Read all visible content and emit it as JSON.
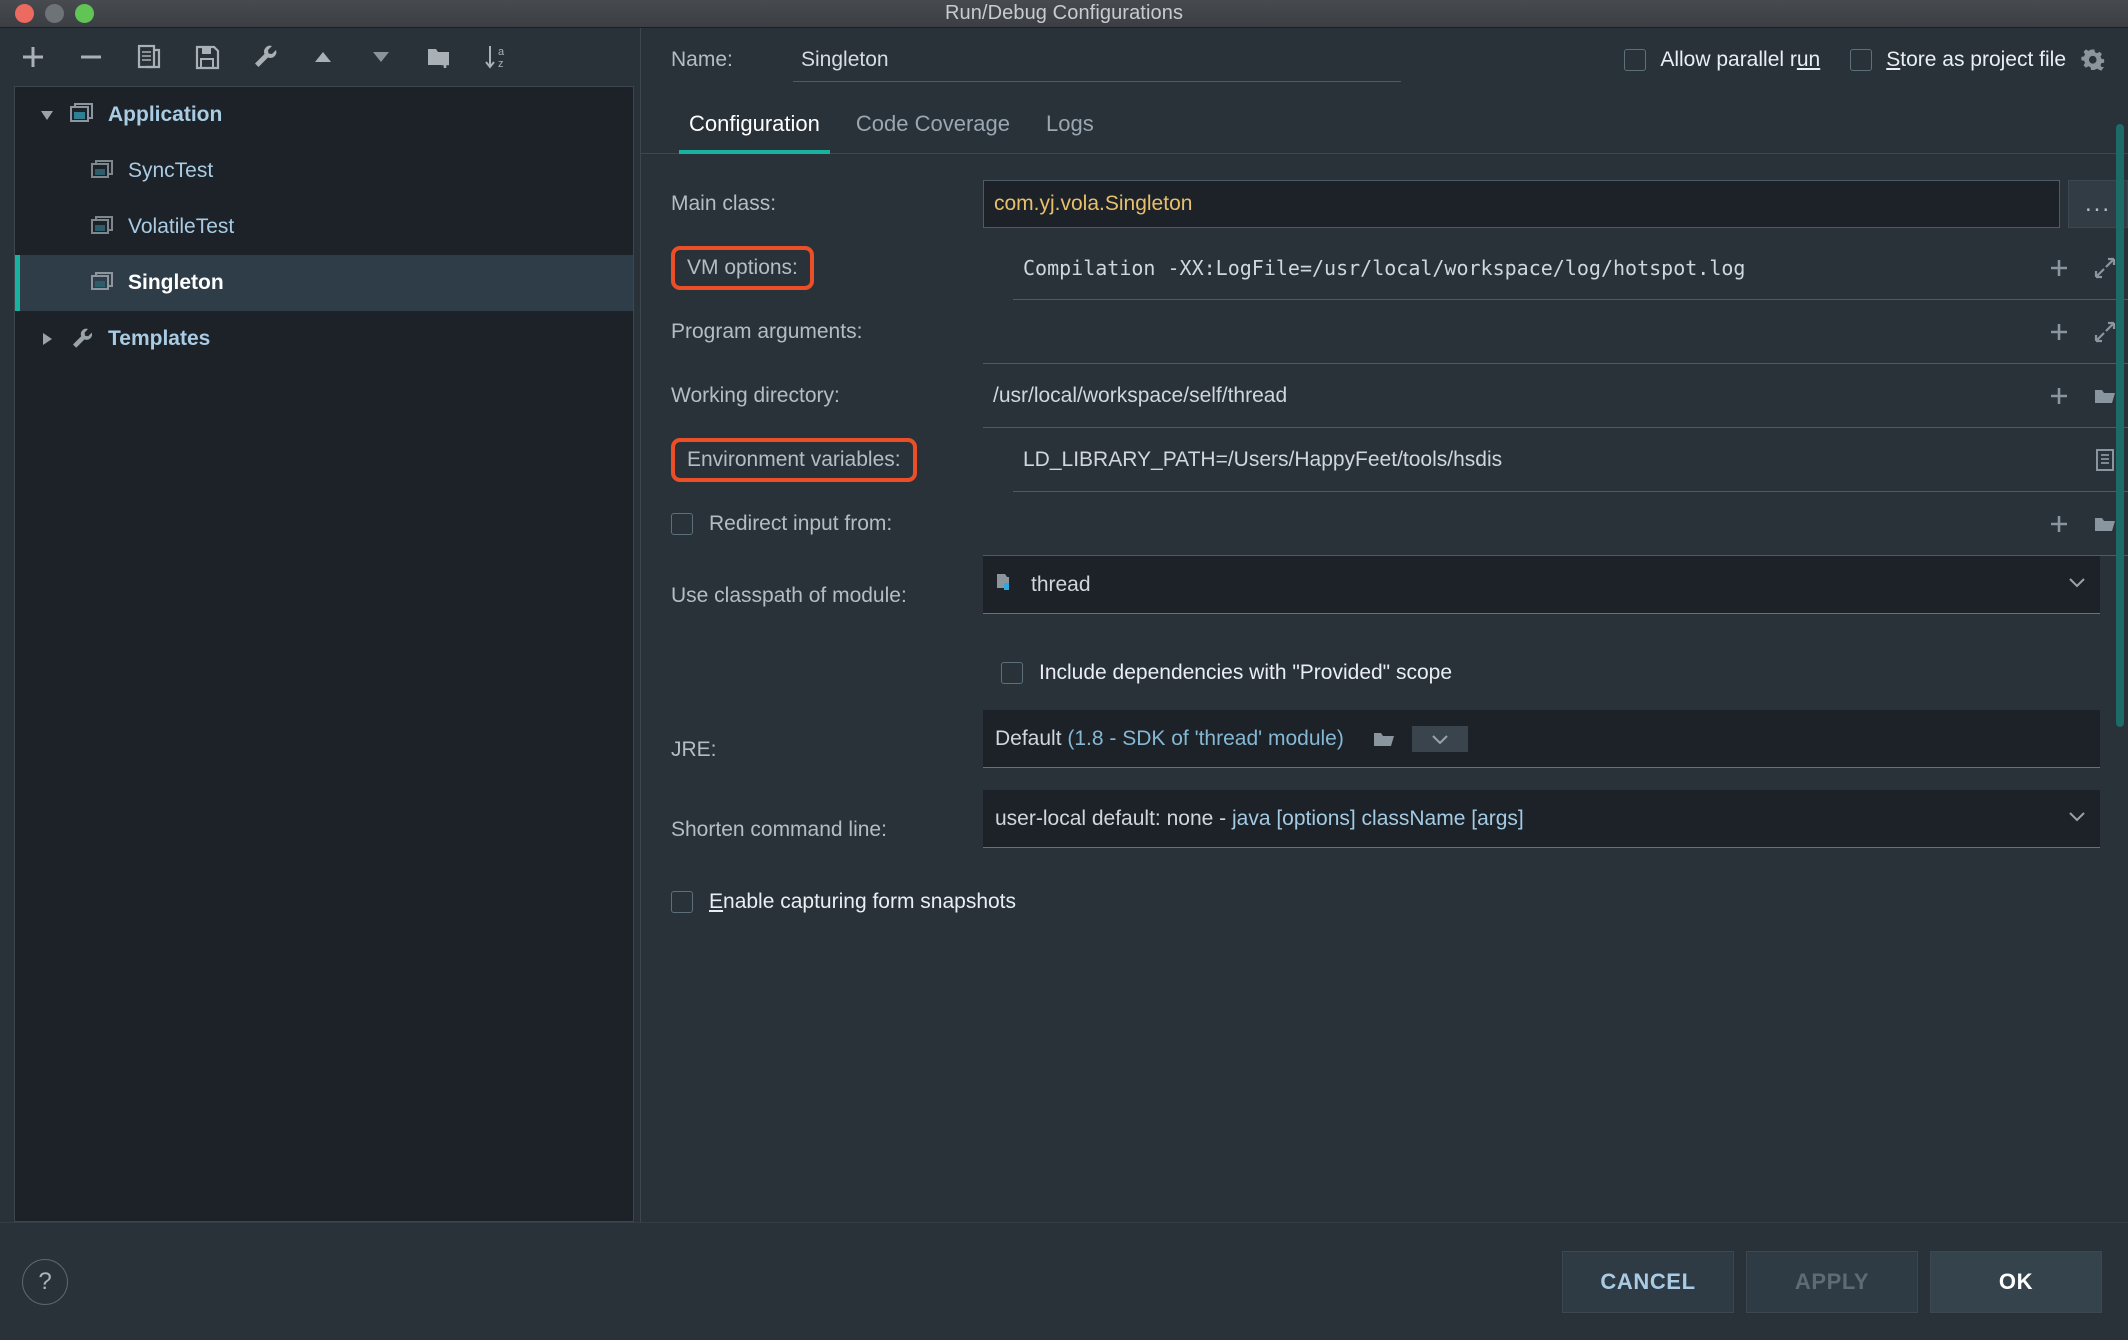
{
  "window": {
    "title": "Run/Debug Configurations"
  },
  "toolbar": {
    "buttons": [
      {
        "name": "add-configuration",
        "icon": "plus-icon"
      },
      {
        "name": "remove-configuration",
        "icon": "minus-icon"
      },
      {
        "name": "copy-configuration",
        "icon": "copy-icon"
      },
      {
        "name": "save-configuration",
        "icon": "save-icon"
      },
      {
        "name": "edit-templates",
        "icon": "wrench-icon"
      },
      {
        "name": "move-up",
        "icon": "triangle-up-icon"
      },
      {
        "name": "move-down",
        "icon": "triangle-down-icon"
      },
      {
        "name": "new-folder",
        "icon": "folder-plus-icon"
      },
      {
        "name": "sort-alphabetically",
        "icon": "sort-az-icon"
      }
    ]
  },
  "tree": {
    "items": [
      {
        "label": "Application",
        "icon": "application-icon",
        "twisty": "expanded",
        "depth": 0,
        "selected": false,
        "bold": true
      },
      {
        "label": "SyncTest",
        "icon": "run-config-icon",
        "twisty": "none",
        "depth": 1,
        "selected": false,
        "bold": false
      },
      {
        "label": "VolatileTest",
        "icon": "run-config-icon",
        "twisty": "none",
        "depth": 1,
        "selected": false,
        "bold": false
      },
      {
        "label": "Singleton",
        "icon": "run-config-icon",
        "twisty": "none",
        "depth": 1,
        "selected": true,
        "bold": true
      },
      {
        "label": "Templates",
        "icon": "wrench-icon",
        "twisty": "collapsed",
        "depth": 0,
        "selected": false,
        "bold": true
      }
    ]
  },
  "header": {
    "name_label": "Name:",
    "name_value": "Singleton",
    "allow_parallel_run": {
      "label_pre": "Allow parallel r",
      "label_mnemonic": "un",
      "label_post": "",
      "checked": false
    },
    "store_as_project_file": {
      "label_mnemonic": "S",
      "label_post": "tore as project file",
      "checked": false
    },
    "gear_icon": "gear-icon"
  },
  "tabs": [
    {
      "label": "Configuration",
      "active": true
    },
    {
      "label": "Code Coverage",
      "active": false
    },
    {
      "label": "Logs",
      "active": false
    }
  ],
  "form": {
    "main_class": {
      "label": "Main class:",
      "value": "com.yj.vola.Singleton",
      "browse": "..."
    },
    "vm_options": {
      "label": "VM options:",
      "value": "Compilation -XX:LogFile=/usr/local/workspace/log/hotspot.log",
      "highlighted": true,
      "icons": [
        "plus-icon",
        "expand-icon"
      ]
    },
    "program_arguments": {
      "label": "Program arguments:",
      "value": "",
      "icons": [
        "plus-icon",
        "expand-icon"
      ]
    },
    "working_directory": {
      "label": "Working directory:",
      "value": "/usr/local/workspace/self/thread",
      "icons": [
        "plus-icon",
        "folder-icon"
      ]
    },
    "environment_variables": {
      "label": "Environment variables:",
      "value": "LD_LIBRARY_PATH=/Users/HappyFeet/tools/hsdis",
      "highlighted": true,
      "icons": [
        "list-icon"
      ]
    },
    "redirect_input": {
      "label": "Redirect input from:",
      "checked": false,
      "value": "",
      "icons": [
        "plus-icon",
        "folder-icon"
      ]
    },
    "use_classpath_of_module": {
      "label": "Use classpath of module:",
      "value": "thread",
      "icon": "module-icon",
      "arrow": "chevron-down-icon"
    },
    "include_dependencies": {
      "label": "Include dependencies with \"Provided\" scope",
      "checked": false
    },
    "jre": {
      "label": "JRE:",
      "value_main": "Default ",
      "value_detail": "(1.8 - SDK of 'thread' module)",
      "browse": "folder-icon",
      "arrow": "chevron-down-icon"
    },
    "shorten_command_line": {
      "label": "Shorten command line:",
      "value_main": "user-local default: none - ",
      "value_detail": "java [options] className [args]",
      "arrow": "chevron-down-icon"
    },
    "enable_capturing": {
      "label_mnemonic": "E",
      "label_post": "nable capturing form snapshots",
      "checked": false
    }
  },
  "footer": {
    "help": "?",
    "buttons": [
      {
        "label": "CANCEL",
        "style": "normal",
        "name": "cancel-button"
      },
      {
        "label": "APPLY",
        "style": "disabled",
        "name": "apply-button"
      },
      {
        "label": "OK",
        "style": "primary",
        "name": "ok-button"
      }
    ]
  },
  "colors": {
    "accent": "#17b2a0",
    "highlight_box": "#ec4f27",
    "main_class_text": "#e8bf6a",
    "link_blue": "#a3cbe4"
  }
}
